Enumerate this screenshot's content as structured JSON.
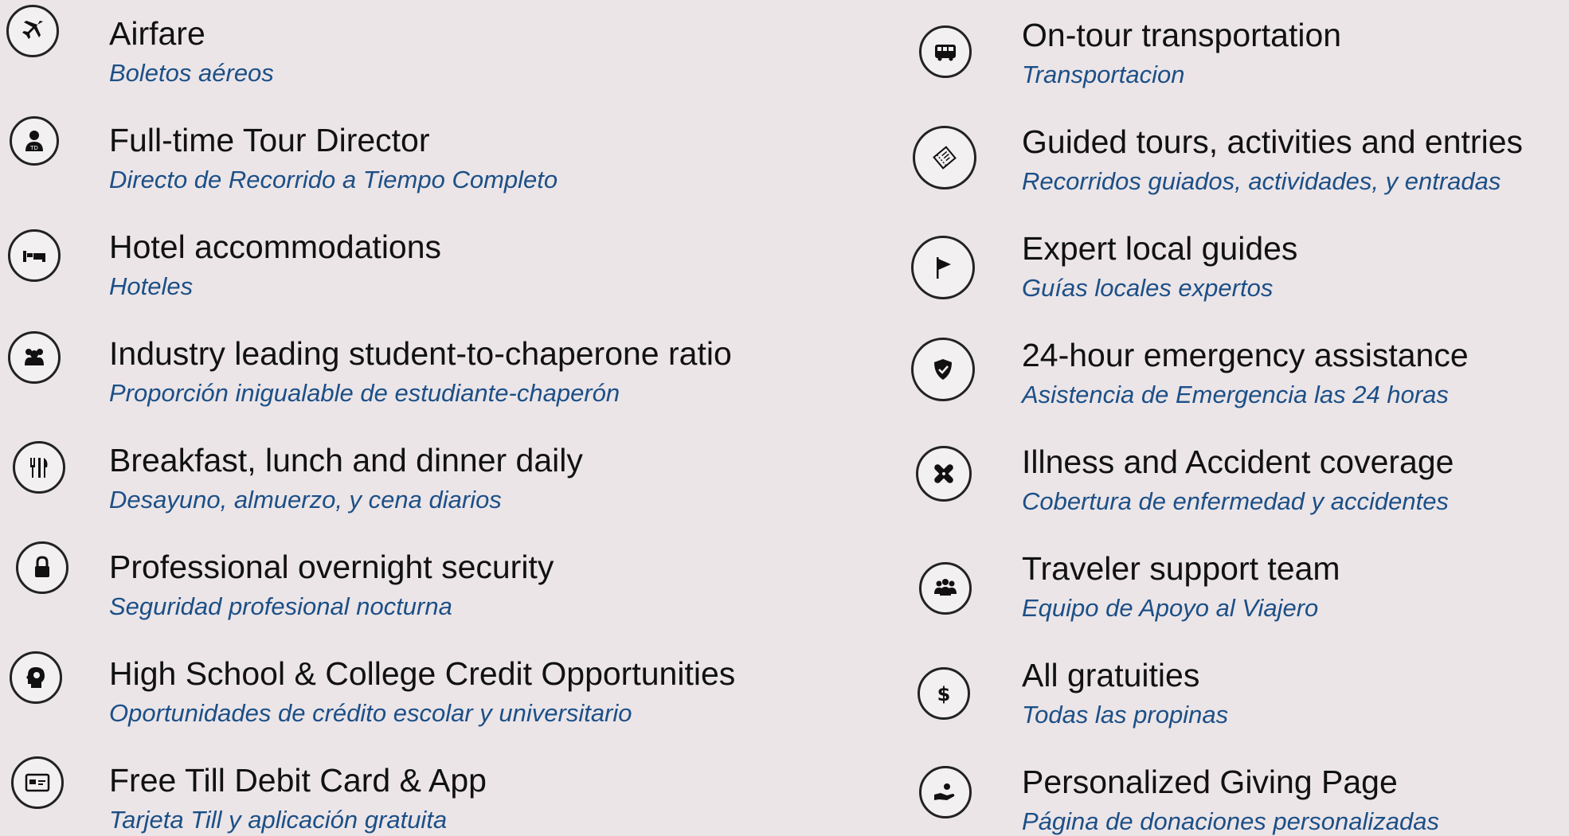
{
  "left_items": [
    {
      "icon": "airplane-icon",
      "title": "Airfare",
      "subtitle": "Boletos aéreos"
    },
    {
      "icon": "tour-director-icon",
      "title": "Full-time Tour Director",
      "subtitle": "Directo de Recorrido a Tiempo Completo"
    },
    {
      "icon": "bed-icon",
      "title": "Hotel accommodations",
      "subtitle": "Hoteles"
    },
    {
      "icon": "group-icon",
      "title": "Industry leading student-to-chaperone ratio",
      "subtitle": "Proporción inigualable de estudiante-chaperón"
    },
    {
      "icon": "utensils-icon",
      "title": "Breakfast, lunch and dinner daily",
      "subtitle": "Desayuno, almuerzo, y cena diarios"
    },
    {
      "icon": "lock-icon",
      "title": "Professional overnight security",
      "subtitle": "Seguridad profesional nocturna"
    },
    {
      "icon": "brain-icon",
      "title": "High School & College Credit Opportunities",
      "subtitle": "Oportunidades de crédito escolar y universitario"
    },
    {
      "icon": "credit-card-icon",
      "title": "Free Till Debit Card & App",
      "subtitle": "Tarjeta Till y aplicación gratuita"
    }
  ],
  "right_items": [
    {
      "icon": "bus-icon",
      "title": "On-tour transportation",
      "subtitle": "Transportacion"
    },
    {
      "icon": "ticket-icon",
      "title": "Guided tours, activities and entries",
      "subtitle": "Recorridos guiados, actividades, y entradas"
    },
    {
      "icon": "flag-icon",
      "title": "Expert local guides",
      "subtitle": "Guías locales expertos"
    },
    {
      "icon": "shield-icon",
      "title": "24-hour emergency assistance",
      "subtitle": "Asistencia de Emergencia las 24 horas"
    },
    {
      "icon": "bandage-icon",
      "title": "Illness and Accident coverage",
      "subtitle": "Cobertura de enfermedad y accidentes"
    },
    {
      "icon": "people-icon",
      "title": "Traveler support team",
      "subtitle": "Equipo de Apoyo al Viajero"
    },
    {
      "icon": "dollar-icon",
      "title": "All gratuities",
      "subtitle": "Todas las propinas"
    },
    {
      "icon": "giving-hand-icon",
      "title": "Personalized Giving Page",
      "subtitle": "Página de donaciones personalizadas"
    }
  ]
}
